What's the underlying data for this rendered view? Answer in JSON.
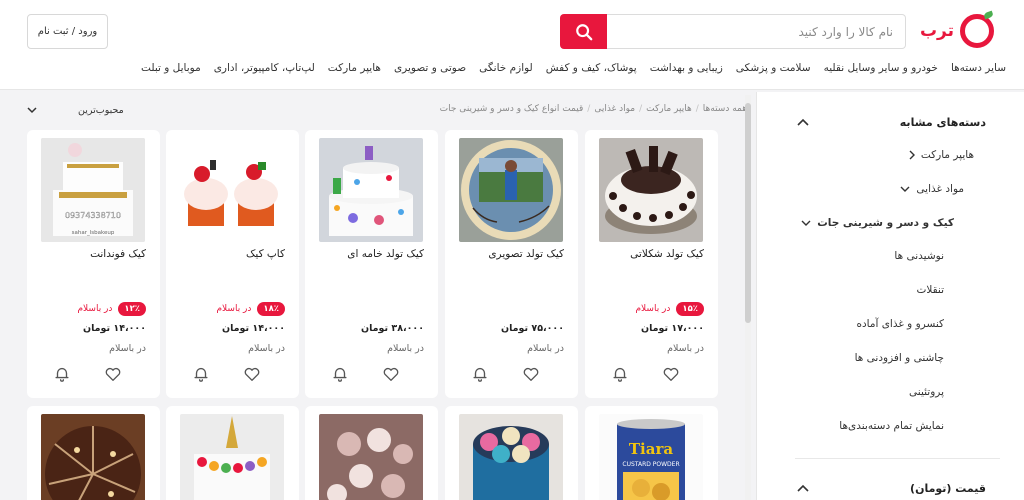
{
  "header": {
    "logo_text": "ترب",
    "search_placeholder": "نام کالا را وارد کنید",
    "login_label": "ورود / ثبت نام"
  },
  "categories_nav": [
    "موبایل و تبلت",
    "لپ‌تاپ، کامپیوتر، اداری",
    "هایپر مارکت",
    "صوتی و تصویری",
    "لوازم خانگی",
    "پوشاک، کیف و کفش",
    "زیبایی و بهداشت",
    "سلامت و پزشکی",
    "خودرو و سایر وسایل نقلیه",
    "سایر دسته‌ها"
  ],
  "breadcrumb": [
    "همه دسته‌ها",
    "هایپر مارکت",
    "مواد غذایی",
    "قیمت انواع کیک و دسر و شیرینی جات"
  ],
  "sort_label": "محبوب‌ترین",
  "sidebar": {
    "similar_title": "دسته‌های مشابه",
    "items": [
      "هایپر مارکت",
      "مواد غذایی",
      "کیک و دسر و شیرینی جات",
      "نوشیدنی ها",
      "تنقلات",
      "کنسرو و غذای آماده",
      "چاشنی و افزودنی ها",
      "پروتئینی",
      "نمایش تمام دسته‌بندی‌ها"
    ],
    "price_title": "قیمت (تومان)"
  },
  "products": [
    {
      "name": "کیک تولد شکلاتی",
      "badge": "۱۵٪",
      "disc_text": "در باسلام",
      "price": "۱۷،۰۰۰ تومان",
      "shop": "در باسلام"
    },
    {
      "name": "کیک تولد تصویری",
      "badge": "",
      "disc_text": "",
      "price": "۷۵،۰۰۰ تومان",
      "shop": "در باسلام"
    },
    {
      "name": "کیک تولد خامه ای",
      "badge": "",
      "disc_text": "",
      "price": "۳۸،۰۰۰ تومان",
      "shop": "در باسلام"
    },
    {
      "name": "کاپ کیک",
      "badge": "۱۸٪",
      "disc_text": "در باسلام",
      "price": "۱۴،۰۰۰ تومان",
      "shop": "در باسلام"
    },
    {
      "name": "کیک فوندانت",
      "badge": "۱۲٪",
      "disc_text": "در باسلام",
      "price": "۱۴،۰۰۰ تومان",
      "shop": "در باسلام"
    }
  ],
  "image_texts": {
    "fondant_phone": "09374338710",
    "fondant_handle": "sahar_lsbakeup",
    "tiara_brand": "Tiara",
    "tiara_label": "CUSTARD POWDER"
  },
  "colors": {
    "accent": "#e8173d",
    "brand_green": "#4caf50"
  }
}
